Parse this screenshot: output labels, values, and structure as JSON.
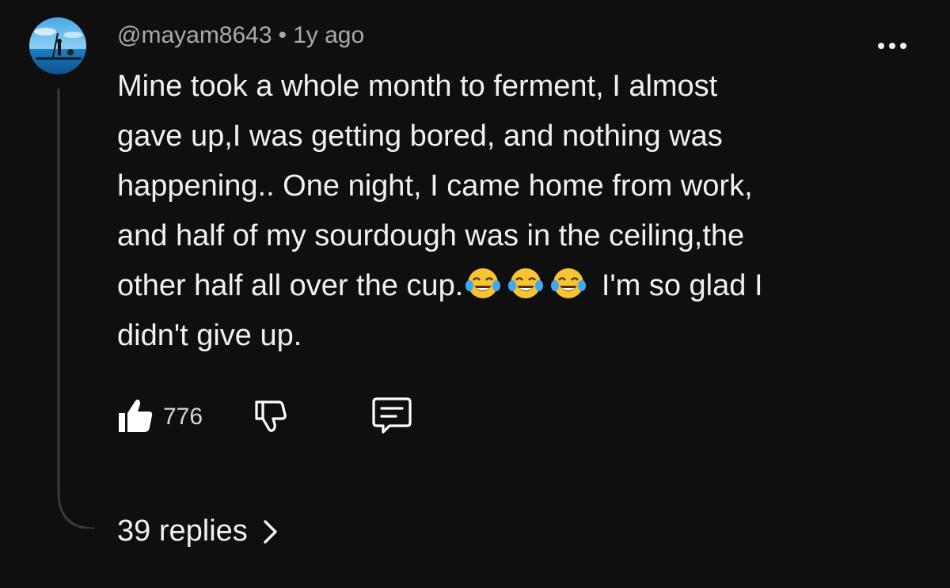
{
  "comment": {
    "author": "@mayam8643",
    "separator": "•",
    "time": "1y ago",
    "text_lines": [
      "Mine took a whole month to ferment, I almost",
      "gave up,I was getting bored, and nothing was",
      "happening.. One night, I came home from work,",
      "and half of my sourdough was in the ceiling,the",
      "other half all over the cup.",
      " I'm so glad I",
      "didn't give up."
    ],
    "emoji_count": 3
  },
  "actions": {
    "like_count": "776"
  },
  "replies": {
    "label": "39 replies"
  },
  "icons": {
    "more": "more-vertical-dots-icon",
    "like": "thumbs-up-icon",
    "dislike": "thumbs-down-icon",
    "reply": "comment-bubble-icon",
    "chevron": "chevron-right-icon",
    "emoji": "face-with-tears-of-joy-emoji"
  },
  "colors": {
    "background": "#0f0f0f",
    "text_primary": "#f1f1f1",
    "text_secondary": "#aaaaaa",
    "thread_line": "#3a3a3a"
  }
}
